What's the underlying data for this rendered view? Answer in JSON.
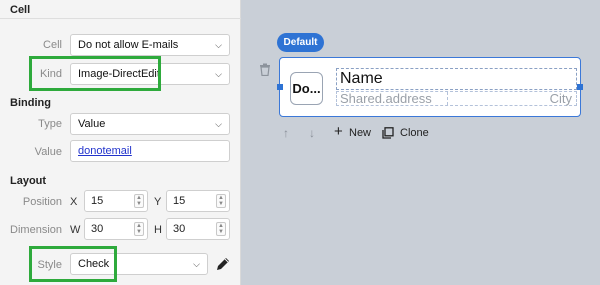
{
  "sections": {
    "cell_title": "Cell",
    "binding_title": "Binding",
    "layout_title": "Layout"
  },
  "fields": {
    "cell_label": "Cell",
    "cell_value": "Do not allow E-mails",
    "kind_label": "Kind",
    "kind_value": "Image-DirectEdit",
    "type_label": "Type",
    "type_value": "Value",
    "value_label": "Value",
    "value_value": "donotemail",
    "position_label": "Position",
    "x_label": "X",
    "x_value": "15",
    "y_label": "Y",
    "y_value": "15",
    "dimension_label": "Dimension",
    "w_label": "W",
    "w_value": "30",
    "h_label": "H",
    "h_value": "30",
    "style_label": "Style",
    "style_value": "Check"
  },
  "preview": {
    "badge": "Default",
    "image_text": "Do...",
    "name": "Name",
    "address": "Shared.address",
    "city": "City"
  },
  "toolbar": {
    "new_label": "New",
    "clone_label": "Clone"
  },
  "colors": {
    "highlight": "#2eaa3c",
    "accent": "#2e73d4",
    "canvas_bg": "#c9cfd7"
  },
  "icons": [
    "chevron-down-icon",
    "pencil-icon",
    "trash-icon",
    "arrow-up-icon",
    "arrow-down-icon",
    "plus-icon",
    "clone-icon"
  ]
}
